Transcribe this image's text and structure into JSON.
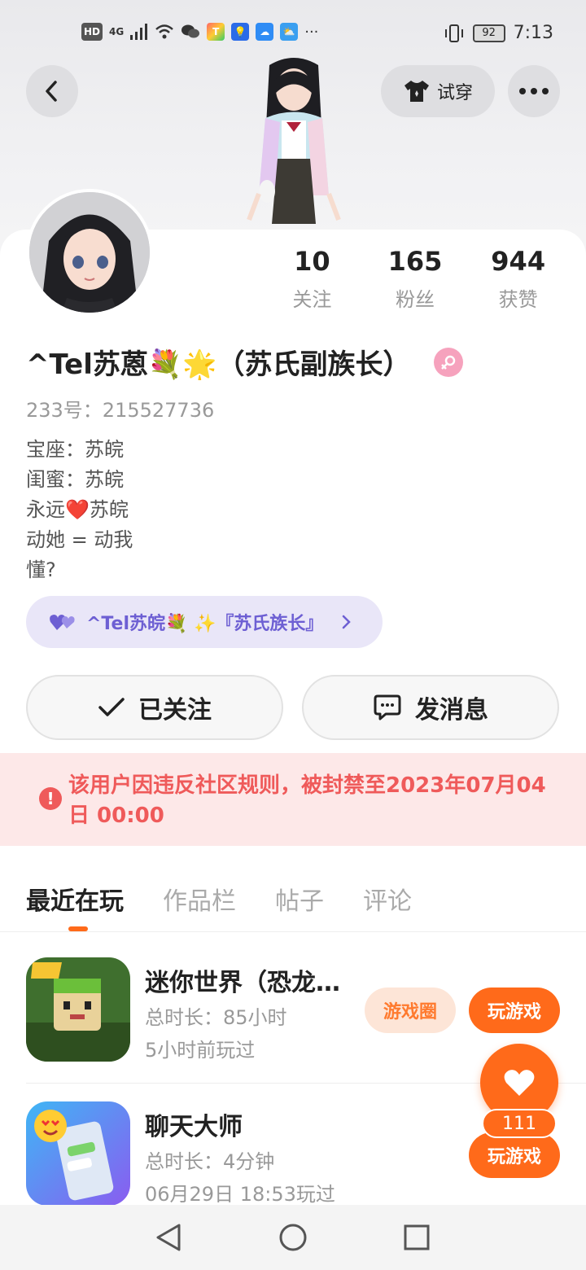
{
  "status_bar": {
    "left_chips": [
      "HD",
      "4G"
    ],
    "battery": "92",
    "time": "7:13"
  },
  "header": {
    "tryon_label": "试穿"
  },
  "stats": [
    {
      "value": "10",
      "label": "关注"
    },
    {
      "value": "165",
      "label": "粉丝"
    },
    {
      "value": "944",
      "label": "获赞"
    }
  ],
  "profile": {
    "name": "^Tel苏蒽💐🌟（苏氏副族长）",
    "uid": "233号：215527736",
    "bio": [
      "宝座：苏皖",
      "闺蜜：苏皖",
      "永远❤️苏皖",
      "动她 = 动我",
      "懂?"
    ],
    "badge": "^Tel苏皖💐 ✨『苏氏族长』"
  },
  "actions": {
    "followed": "已关注",
    "message": "发消息"
  },
  "ban_notice": "该用户因违反社区规则，被封禁至2023年07月04日 00:00",
  "tabs": [
    "最近在玩",
    "作品栏",
    "帖子",
    "评论"
  ],
  "games": [
    {
      "name": "迷你世界（恐龙…",
      "duration": "总时长：85小时",
      "last_played": "5小时前玩过",
      "circle_label": "游戏圈",
      "play_label": "玩游戏"
    },
    {
      "name": "聊天大师",
      "duration": "总时长：4分钟",
      "last_played": "06月29日 18:53玩过",
      "play_label": "玩游戏"
    }
  ],
  "fab": {
    "count": "111"
  },
  "colors": {
    "accent": "#ff6a1a",
    "ban_bg": "#fde8e8",
    "ban_text": "#ef5a5a",
    "badge_bg": "#e9e6f8",
    "gender": "#f6a2bd"
  }
}
